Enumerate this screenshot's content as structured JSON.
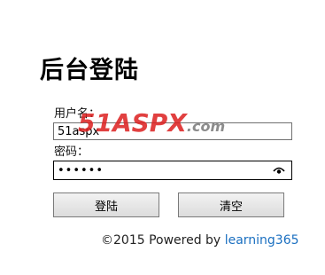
{
  "page": {
    "title": "后台登陆"
  },
  "form": {
    "username_label": "用户名：",
    "username_value": "51aspx",
    "password_label": "密码：",
    "password_value": "123456",
    "login_button": "登陆",
    "clear_button": "清空"
  },
  "footer": {
    "copyright_text": "©2015 Powered by",
    "link_text": "learning365",
    "link_color": "#1a6fc0"
  },
  "watermark": {
    "brand_main": "51ASPX",
    "brand_suffix": ".com",
    "brand_color": "#dc1e1e"
  },
  "icons": {
    "password_reveal": "eye-icon"
  }
}
